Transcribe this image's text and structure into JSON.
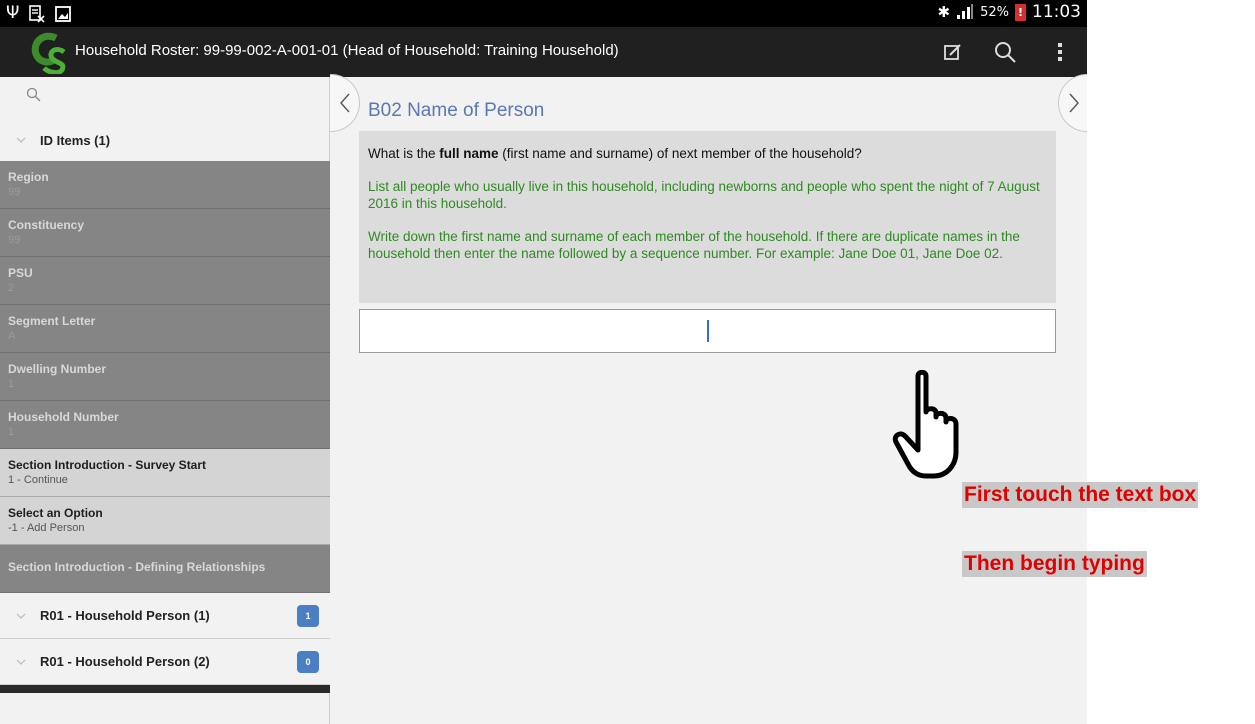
{
  "status_bar": {
    "battery": "52%",
    "time": "11:03",
    "icons": [
      "usb-icon",
      "no-sim-icon",
      "image-icon",
      "bluetooth-icon",
      "signal-icon",
      "battery-icon"
    ]
  },
  "action_bar": {
    "title": "Household Roster: 99-99-002-A-001-01 (Head of Household: Training Household)",
    "icons": [
      "cs-logo",
      "edit-icon",
      "search-icon",
      "overflow-menu-icon"
    ]
  },
  "left_panel": {
    "group_header": "ID Items (1)",
    "items": [
      {
        "title": "Region",
        "value": "99",
        "style": "dark"
      },
      {
        "title": "Constituency",
        "value": "99",
        "style": "dark"
      },
      {
        "title": "PSU",
        "value": "2",
        "style": "dark"
      },
      {
        "title": "Segment Letter",
        "value": "A",
        "style": "dark"
      },
      {
        "title": "Dwelling Number",
        "value": "1",
        "style": "dark"
      },
      {
        "title": "Household Number",
        "value": "1",
        "style": "dark"
      },
      {
        "title": "Section Introduction - Survey Start",
        "value": "1 - Continue",
        "style": "light"
      },
      {
        "title": "Select an Option",
        "value": "-1 - Add Person",
        "style": "light"
      },
      {
        "title": "Section Introduction - Defining Relationships",
        "value": "",
        "style": "dark"
      }
    ],
    "rosters": [
      {
        "label": "R01 - Household Person (1)",
        "badge": "1"
      },
      {
        "label": "R01 - Household Person (2)",
        "badge": "0"
      }
    ]
  },
  "question": {
    "title": "B02 Name of Person",
    "text_before": "What is the ",
    "text_bold": "full name",
    "text_after": " (first name and surname) of next member of the household?",
    "help_1": "List all people who usually live in this household, including newborns and people who spent the night of 7 August 2016  in this household.",
    "help_2": "Write down the first name and surname of each member of the household. If there are duplicate names in the household then enter the name followed by a sequence number. For example: Jane Doe 01, Jane Doe 02.",
    "answer_value": ""
  },
  "annotations": {
    "callout_1": "First touch the text box",
    "callout_2": "Then begin typing",
    "hand_icon": "pointing-hand-icon"
  },
  "colors": {
    "title_blue": "#5b78b4",
    "help_green": "#2f8a22",
    "callout_red": "#e00000",
    "badge_blue": "#4a7fc1"
  }
}
